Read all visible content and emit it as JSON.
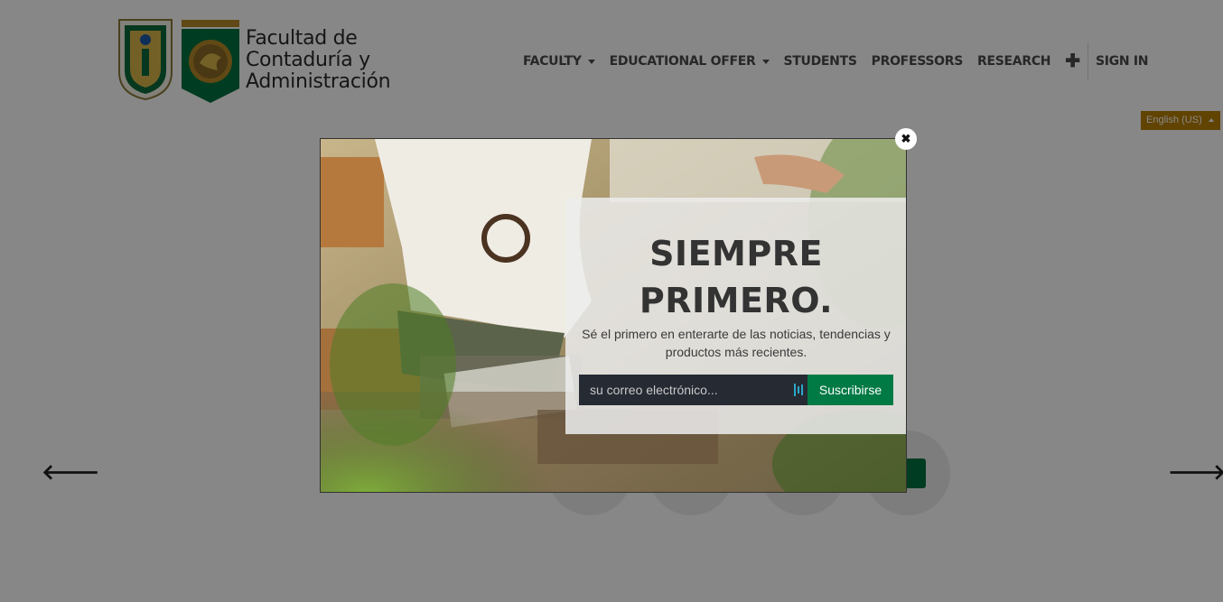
{
  "brand": {
    "name_lines": [
      "Facultad de",
      "Contaduría y",
      "Administración"
    ],
    "colors": {
      "gold": "#b87f05",
      "green": "#00723f"
    }
  },
  "nav": {
    "items": [
      {
        "label": "FACULTY",
        "dropdown": true
      },
      {
        "label": "EDUCATIONAL OFFER",
        "dropdown": true
      },
      {
        "label": "STUDENTS",
        "dropdown": false
      },
      {
        "label": "PROFESSORS",
        "dropdown": false
      },
      {
        "label": "RESEARCH",
        "dropdown": false
      }
    ],
    "plus_icon": "plus-icon",
    "sign_in": "SIGN IN"
  },
  "language": {
    "selected": "English (US)"
  },
  "carousel": {
    "prev_icon": "arrow-left-icon",
    "next_icon": "arrow-right-icon"
  },
  "modal": {
    "headline_line1": "SIEMPRE",
    "headline_line2": "PRIMERO.",
    "subtitle": "Sé el primero en enterarte de las noticias, tendencias y productos más recientes.",
    "email_placeholder": "su correo electrónico...",
    "subscribe_label": "Suscribirse",
    "close_icon": "close-icon"
  }
}
